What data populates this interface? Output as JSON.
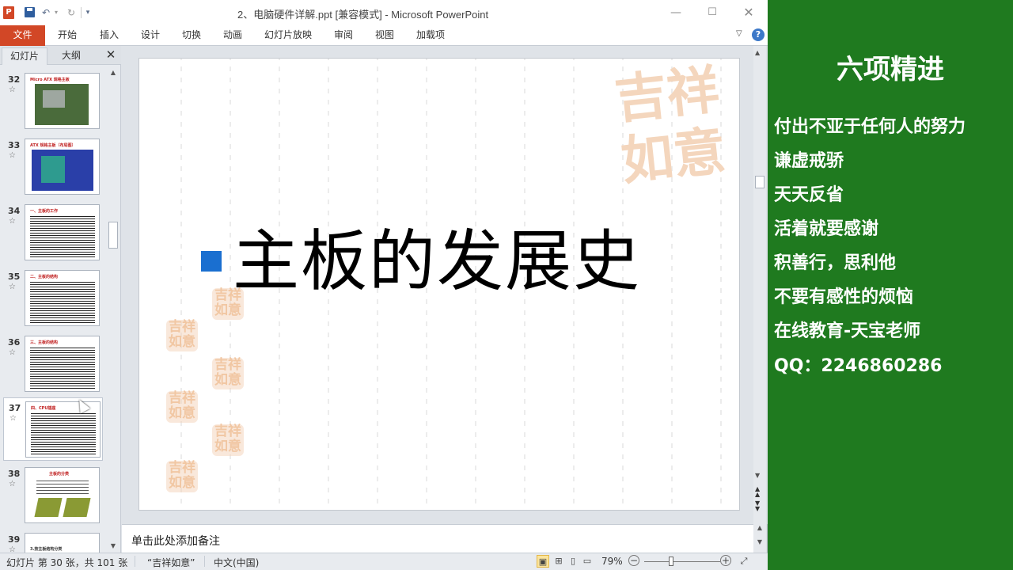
{
  "window": {
    "app_icon": "P",
    "title": "2、电脑硬件详解.ppt [兼容模式]  -  Microsoft PowerPoint",
    "controls": {
      "minimize": "—",
      "maximize": "☐",
      "close": "✕"
    }
  },
  "qat": {
    "undo": "↶",
    "undo_dropdown": "▾",
    "redo": "↻",
    "customize": "▾"
  },
  "ribbon": {
    "file_tab": "文件",
    "tabs": [
      "开始",
      "插入",
      "设计",
      "切换",
      "动画",
      "幻灯片放映",
      "审阅",
      "视图",
      "加载项"
    ],
    "collapse": "▽",
    "help": "?"
  },
  "pane": {
    "tabs": [
      "幻灯片",
      "大纲"
    ],
    "close": "✕",
    "star": "☆",
    "thumbnails": [
      {
        "number": "32",
        "title": "Micro ATX 规格主板",
        "kind": "board"
      },
      {
        "number": "33",
        "title": "ATX 规格主板（布局图）",
        "kind": "diagram"
      },
      {
        "number": "34",
        "title": "一、主板的工作",
        "kind": "text"
      },
      {
        "number": "35",
        "title": "二、主板的结构",
        "kind": "text"
      },
      {
        "number": "36",
        "title": "三、主板的结构",
        "kind": "text"
      },
      {
        "number": "37",
        "title": "四、CPU插座",
        "kind": "text",
        "selected": true
      },
      {
        "number": "38",
        "title": "主板的分类",
        "kind": "pictures"
      },
      {
        "number": "39",
        "title": "3.按主板结构分类",
        "kind": "text"
      }
    ]
  },
  "slide": {
    "title": "主板的发展史",
    "watermark": "吉祥如意",
    "bullet_color": "#1a6fd0"
  },
  "notes": {
    "placeholder": "单击此处添加备注"
  },
  "status": {
    "slide_info": "幻灯片 第 30 张，共 101 张",
    "theme": "“吉祥如意”",
    "language": "中文(中国)",
    "zoom": "79%",
    "zoom_out": "−",
    "zoom_in": "+"
  },
  "sidepanel": {
    "title": "六项精进",
    "items": [
      "付出不亚于任何人的努力",
      "谦虚戒骄",
      "天天反省",
      "活着就要感谢",
      "积善行，思利他",
      "不要有感性的烦恼",
      "在线教育-天宝老师",
      "QQ：2246860286"
    ],
    "background": "#1f7a1f"
  }
}
